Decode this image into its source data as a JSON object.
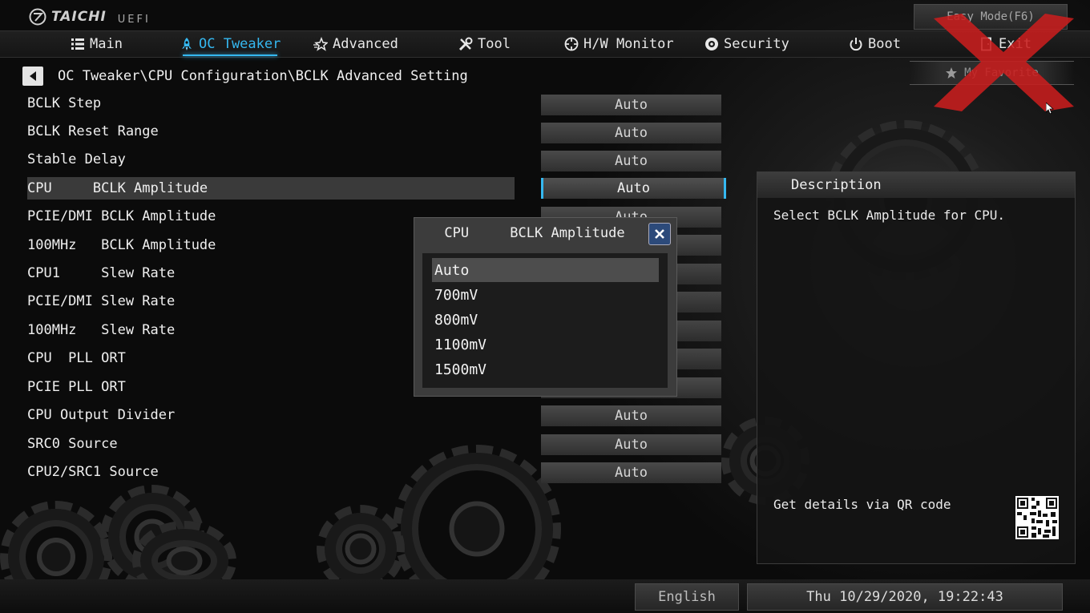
{
  "brand": {
    "name": "TAICHI",
    "sub": "UEFI"
  },
  "easy_mode_label": "Easy Mode(F6)",
  "tabs": [
    {
      "label": "Main",
      "icon": "list-icon"
    },
    {
      "label": "OC Tweaker",
      "icon": "rocket-icon"
    },
    {
      "label": "Advanced",
      "icon": "star-icon"
    },
    {
      "label": "Tool",
      "icon": "tools-icon"
    },
    {
      "label": "H/W Monitor",
      "icon": "crosshair-icon"
    },
    {
      "label": "Security",
      "icon": "shield-icon"
    },
    {
      "label": "Boot",
      "icon": "power-icon"
    },
    {
      "label": "Exit",
      "icon": "exit-door-icon"
    }
  ],
  "active_tab": "OC Tweaker",
  "favorite_label": "My Favorite",
  "breadcrumb": "OC Tweaker\\CPU Configuration\\BCLK Advanced Setting",
  "settings": [
    {
      "label": "BCLK Step",
      "value": "Auto"
    },
    {
      "label": "BCLK Reset Range",
      "value": "Auto"
    },
    {
      "label": "Stable Delay",
      "value": "Auto"
    },
    {
      "label": "CPU     BCLK Amplitude",
      "value": "Auto"
    },
    {
      "label": "PCIE/DMI BCLK Amplitude",
      "value": "Auto"
    },
    {
      "label": "100MHz   BCLK Amplitude",
      "value": "Auto"
    },
    {
      "label": "CPU1     Slew Rate",
      "value": ""
    },
    {
      "label": "PCIE/DMI Slew Rate",
      "value": ""
    },
    {
      "label": "100MHz   Slew Rate",
      "value": ""
    },
    {
      "label": "CPU  PLL ORT",
      "value": ""
    },
    {
      "label": "PCIE PLL ORT",
      "value": "Auto"
    },
    {
      "label": "CPU Output Divider",
      "value": "Auto"
    },
    {
      "label": "SRC0 Source",
      "value": "Auto"
    },
    {
      "label": "CPU2/SRC1 Source",
      "value": "Auto"
    }
  ],
  "selected_setting": "CPU     BCLK Amplitude",
  "popup": {
    "title": "CPU     BCLK Amplitude",
    "options": [
      "Auto",
      "700mV",
      "800mV",
      "1100mV",
      "1500mV"
    ],
    "selected": "Auto"
  },
  "description": {
    "title": "Description",
    "text": "Select BCLK Amplitude for CPU.",
    "qr_label": "Get details via QR code"
  },
  "footer": {
    "language": "English",
    "datetime": "Thu 10/29/2020, 19:22:43"
  },
  "colors": {
    "accent": "#35b8f0",
    "overlay_x": "#c81e1e"
  }
}
